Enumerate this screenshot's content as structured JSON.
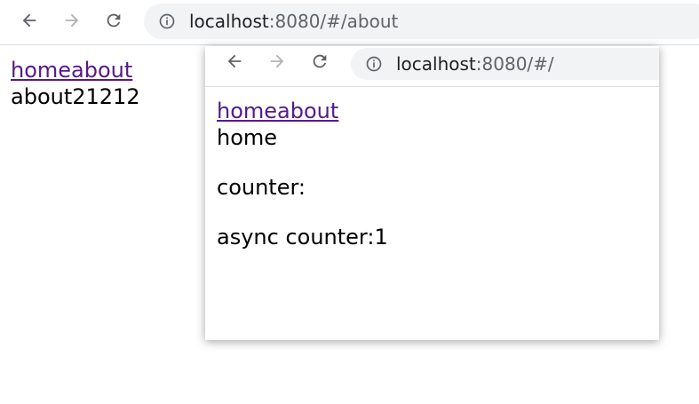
{
  "main_browser": {
    "url_host": "localhost",
    "url_rest": ":8080/#/about",
    "links": [
      "home",
      "about"
    ],
    "page_text": "about21212"
  },
  "popup_browser": {
    "url_host": "localhost",
    "url_rest": ":8080/#/",
    "links": [
      "home",
      "about"
    ],
    "view_text": "home",
    "counter_label": "counter:",
    "async_counter_label": "async counter:1"
  },
  "icons": {
    "back": "arrow-left-icon",
    "forward": "arrow-right-icon",
    "reload": "reload-icon",
    "info": "info-icon"
  },
  "colors": {
    "link_visited": "#551a8b",
    "omnibox_bg": "#f1f3f4",
    "icon_active": "#5f6368",
    "icon_disabled": "#b0b3b7"
  }
}
